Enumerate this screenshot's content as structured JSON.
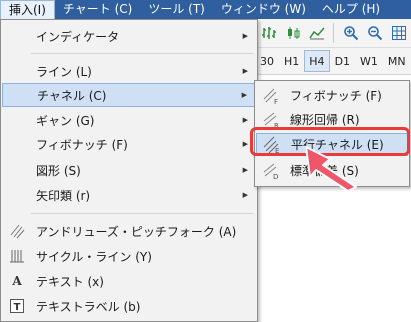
{
  "menubar": {
    "items": [
      {
        "label": "挿入(I)",
        "active": true
      },
      {
        "label": "チャート (C)"
      },
      {
        "label": "ツール (T)"
      },
      {
        "label": "ウィンドウ (W)"
      },
      {
        "label": "ヘルプ (H)"
      }
    ]
  },
  "toolbar": {
    "icons": [
      "chart-bar-icon",
      "candlestick-icon",
      "line-chart-icon",
      "zoom-in-icon",
      "zoom-out-icon",
      "grid-icon"
    ]
  },
  "timeframes": {
    "items": [
      "30",
      "H1",
      "H4",
      "D1",
      "W1",
      "MN"
    ],
    "active": "H4"
  },
  "insert_menu": {
    "indicators": "インディケータ",
    "line": "ライン (L)",
    "channel": "チャネル (C)",
    "gann": "ギャン (G)",
    "fibonacci": "フィボナッチ (F)",
    "shapes": "図形 (S)",
    "arrows": "矢印類 (r)",
    "andrews": "アンドリューズ・ピッチフォーク (A)",
    "cycle": "サイクル・ライン (Y)",
    "text": "テキスト (x)",
    "text_label": "テキストラベル (b)"
  },
  "channel_submenu": {
    "fibonacci": "フィボナッチ (F)",
    "regression": "線形回帰 (R)",
    "parallel": "平行チャネル (E)",
    "stddev": "標準偏差 (S)"
  },
  "colors": {
    "menubar_bg": "#2f5f9e",
    "highlight_red": "#ea3b3b",
    "selection_blue": "#cfe0f5"
  }
}
